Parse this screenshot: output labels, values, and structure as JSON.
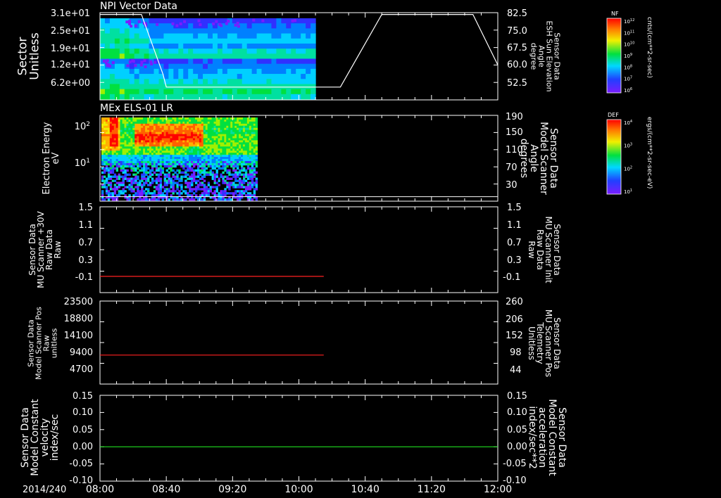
{
  "chart_data": [
    {
      "type": "heatmap",
      "title": "NPI Vector Data",
      "ylabel": "Sector\nUnitless",
      "yticks": [
        "3.1e+01",
        "2.5e+01",
        "1.9e+01",
        "1.2e+01",
        "6.2e+00"
      ],
      "y2label": "Sensor Data\nESH Sun Elevation\nAngle\ndegree",
      "y2ticks": [
        "82.5",
        "75.0",
        "67.5",
        "60.0",
        "52.5"
      ],
      "y2lim": [
        45,
        82.5
      ],
      "overlay_line": {
        "x": [
          "08:00",
          "08:25",
          "08:38",
          "08:40",
          "10:25",
          "10:50",
          "11:25",
          "11:45",
          "12:00"
        ],
        "y": [
          81.7,
          81.7,
          56.0,
          50.5,
          50.5,
          81.7,
          81.7,
          81.7,
          60.0
        ]
      },
      "data_extent": [
        "08:00",
        "10:10"
      ],
      "colorbar": {
        "tag": "NF",
        "label": "cnts/(cm**2-sr-sec)",
        "ticks": [
          "10^12",
          "10^11",
          "10^10",
          "10^9",
          "10^8",
          "10^7",
          "10^6"
        ]
      }
    },
    {
      "type": "heatmap",
      "title": "MEx ELS-01 LR",
      "ylabel": "Electron Energy\neV",
      "yticks": [
        "10^2",
        "10^1"
      ],
      "y2label": "Sensor Data\nModel Scanner\nAngle\ndegrees",
      "y2ticks": [
        "190",
        "150",
        "110",
        "70",
        "30"
      ],
      "y2lim": [
        0,
        190
      ],
      "overlay_line": {
        "x": [
          "08:00",
          "12:00"
        ],
        "y": [
          10,
          10
        ]
      },
      "data_extent": [
        "08:00",
        "09:35"
      ],
      "colorbar": {
        "tag": "DEF",
        "label": "ergs/(cm**2-sr-sec-eV)",
        "ticks": [
          "10^4",
          "10^3",
          "10^2",
          "10^1"
        ]
      }
    },
    {
      "type": "line",
      "ylabel": "Sensor Data\nMU Scanner +30V\nRaw Data\nRaw",
      "yticks": [
        "1.5",
        "1.1",
        "0.7",
        "0.3",
        "-0.1"
      ],
      "ylim": [
        -0.35,
        1.5
      ],
      "y2label": "Sensor Data\nMU Scanner Init\nRaw Data\nRaw",
      "y2ticks": [
        "1.5",
        "1.1",
        "0.7",
        "0.3",
        "-0.1"
      ],
      "series": [
        {
          "x": [
            "08:00",
            "10:15"
          ],
          "y": [
            0.0,
            0.0
          ],
          "color": "#ff2020"
        }
      ]
    },
    {
      "type": "line",
      "ylabel": "Sensor Data\nModel Scanner Pos\nRaw\nunitless",
      "yticks": [
        "23500",
        "18800",
        "14100",
        "9400",
        "4700"
      ],
      "ylim": [
        0,
        23500
      ],
      "y2label": "Sensor Data\nMU Scanner Pos\nTelemetry\nUnitless",
      "y2ticks": [
        "260",
        "206",
        "152",
        "98",
        "44"
      ],
      "series": [
        {
          "x": [
            "08:00",
            "10:15"
          ],
          "y": [
            8200,
            8200
          ],
          "color": "#ff2020"
        }
      ]
    },
    {
      "type": "line",
      "ylabel": "Sensor Data\nModel Constant\nvelocity\nindex/sec",
      "yticks": [
        "0.15",
        "0.10",
        "0.05",
        "0.00",
        "-0.05",
        "-0.10"
      ],
      "ylim": [
        -0.1,
        0.15
      ],
      "y2label": "Sensor Data\nModel Constant\nacceleration\nindex/sec**2",
      "y2ticks": [
        "0.15",
        "0.10",
        "0.05",
        "0.00",
        "-0.05",
        "-0.10"
      ],
      "series": [
        {
          "x": [
            "08:00",
            "12:00"
          ],
          "y": [
            0.0,
            0.0
          ],
          "color": "#20e020"
        }
      ]
    }
  ],
  "xaxis": {
    "date_label": "2014/240",
    "ticks": [
      "08:00",
      "08:40",
      "09:20",
      "10:00",
      "10:40",
      "11:20",
      "12:00"
    ],
    "range": [
      "08:00",
      "12:00"
    ]
  },
  "colors": {
    "red_label": "#ff2020",
    "green_label": "#20e020"
  }
}
